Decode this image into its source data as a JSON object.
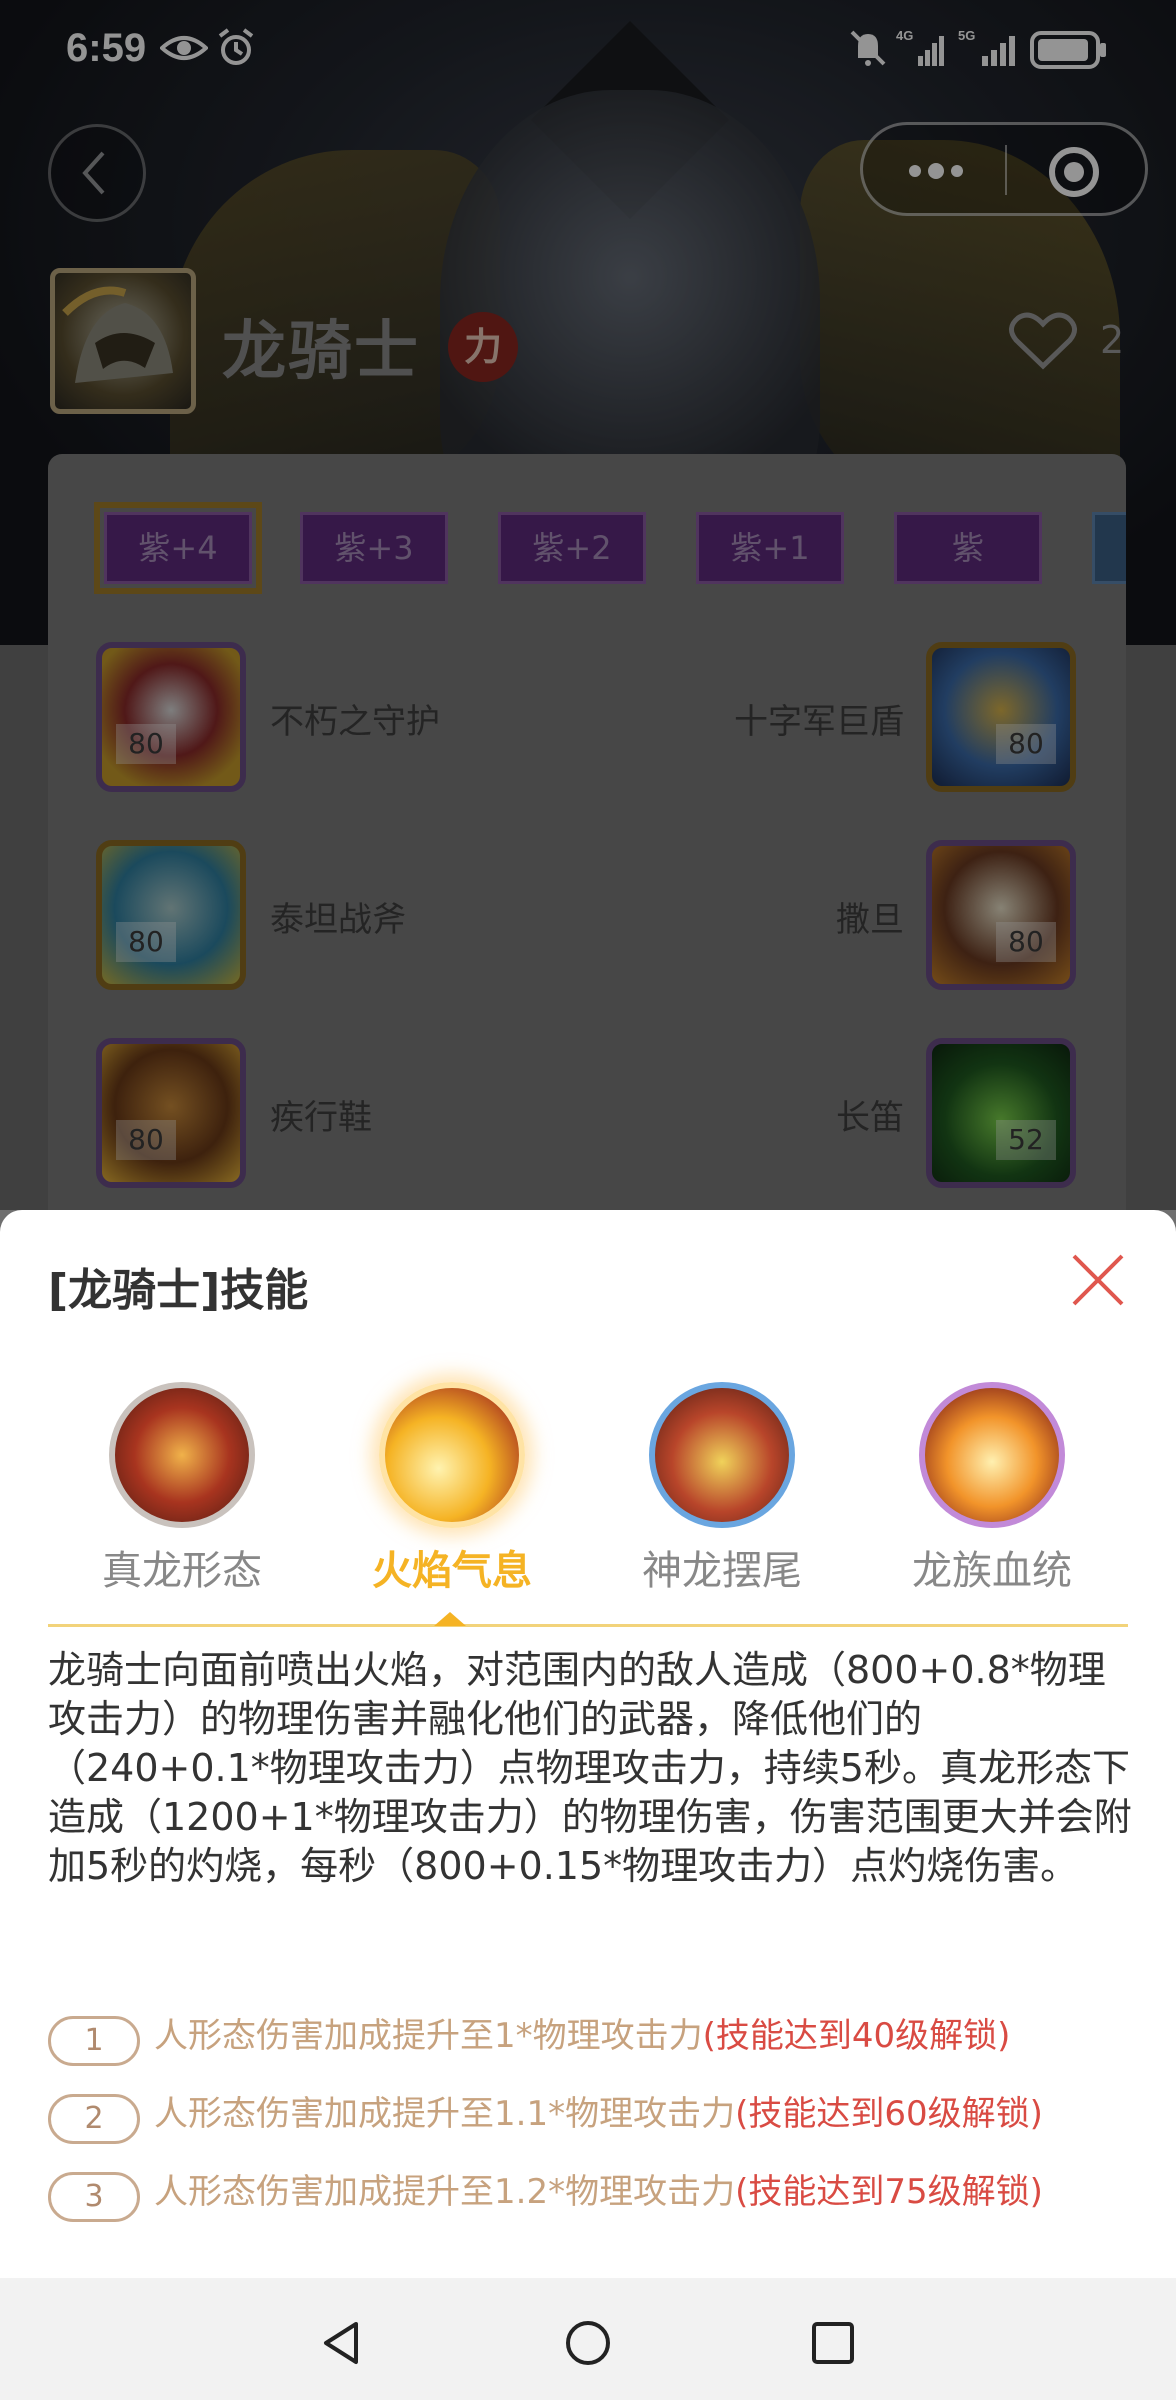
{
  "status": {
    "time": "6:59",
    "net1": "4G",
    "net2": "5G"
  },
  "hero": {
    "name": "龙骑士",
    "attribute_badge": "力",
    "like_count": "2"
  },
  "tiers": [
    {
      "label": "紫+4",
      "active": true
    },
    {
      "label": "紫+3",
      "active": false
    },
    {
      "label": "紫+2",
      "active": false
    },
    {
      "label": "紫+1",
      "active": false
    },
    {
      "label": "紫",
      "active": false
    }
  ],
  "equipment": [
    {
      "name": "不朽之守护",
      "level": "80",
      "side": "left"
    },
    {
      "name": "十字军巨盾",
      "level": "80",
      "side": "right"
    },
    {
      "name": "泰坦战斧",
      "level": "80",
      "side": "left"
    },
    {
      "name": "撒旦",
      "level": "80",
      "side": "right"
    },
    {
      "name": "疾行鞋",
      "level": "80",
      "side": "left"
    },
    {
      "name": "长笛",
      "level": "52",
      "side": "right"
    }
  ],
  "sheet": {
    "title": "[龙骑士]技能",
    "skills": [
      {
        "name": "真龙形态",
        "active": false
      },
      {
        "name": "火焰气息",
        "active": true
      },
      {
        "name": "神龙摆尾",
        "active": false
      },
      {
        "name": "龙族血统",
        "active": false
      }
    ],
    "description": "龙骑士向面前喷出火焰，对范围内的敌人造成（800+0.8*物理攻击力）的物理伤害并融化他们的武器，降低他们的（240+0.1*物理攻击力）点物理攻击力，持续5秒。真龙形态下造成（1200+1*物理攻击力）的物理伤害，伤害范围更大并会附加5秒的灼烧，每秒（800+0.15*物理攻击力）点灼烧伤害。",
    "upgrades": [
      {
        "num": "1",
        "text": "人形态伤害加成提升至1*物理攻击力",
        "lock": "(技能达到40级解锁)"
      },
      {
        "num": "2",
        "text": "人形态伤害加成提升至1.1*物理攻击力",
        "lock": "(技能达到60级解锁)"
      },
      {
        "num": "3",
        "text": "人形态伤害加成提升至1.2*物理攻击力",
        "lock": "(技能达到75级解锁)"
      }
    ]
  },
  "colors": {
    "accent_gold": "#f5b324",
    "lock_red": "#d94b43",
    "close_red": "#e0574e"
  }
}
